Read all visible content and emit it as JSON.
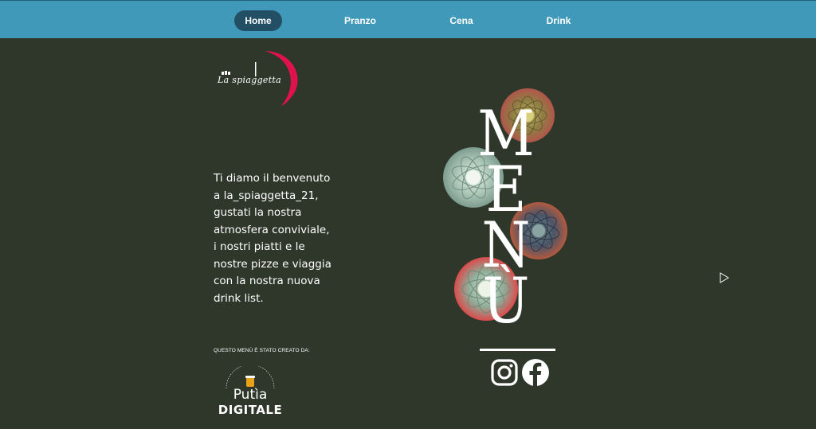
{
  "nav": {
    "items": [
      {
        "label": "Home",
        "active": true
      },
      {
        "label": "Pranzo",
        "active": false
      },
      {
        "label": "Cena",
        "active": false
      },
      {
        "label": "Drink",
        "active": false
      }
    ]
  },
  "brand": {
    "logo_text": "La spiaggetta",
    "accent_color": "#e0124e"
  },
  "welcome": {
    "lines": [
      "Ti diamo il benvenuto",
      "a la_spiaggetta_21,",
      "gustati la nostra",
      "atmosfera conviviale,",
      "i nostri piatti e le",
      "nostre pizze e viaggia",
      "con la nostra nuova",
      "drink list."
    ]
  },
  "menu_title": {
    "letters": [
      "M",
      "E",
      "N",
      "Ù"
    ]
  },
  "credit": {
    "label": "QUESTO MENÙ È STATO CREATO DA:",
    "ring_text": "CONTENT DESIGN FACTORY",
    "name": "Putìa",
    "sub": "DIGITALE"
  },
  "social": {
    "instagram_icon": "instagram-icon",
    "facebook_icon": "facebook-icon"
  },
  "colors": {
    "background": "#2f372b",
    "nav_bar": "#4199b9",
    "nav_active": "#234f64"
  }
}
